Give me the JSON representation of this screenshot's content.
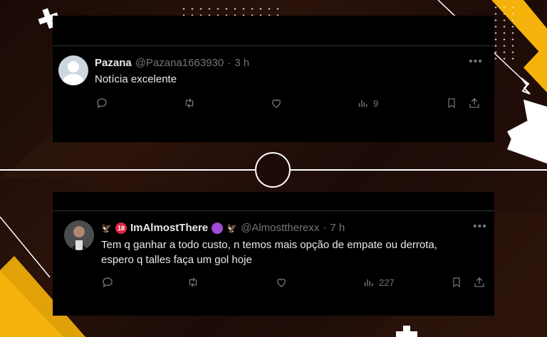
{
  "colors": {
    "accent": "#f5b20a",
    "card_bg": "#000000",
    "text": "#e7e9ea",
    "muted": "#71767b"
  },
  "tweets": [
    {
      "name": "Pazana",
      "handle": "@Pazana1663930",
      "separator": "·",
      "time": "3 h",
      "text": "Notícia excelente",
      "views": "9",
      "icons": [
        "reply-icon",
        "retweet-icon",
        "like-icon",
        "views-icon",
        "bookmark-icon",
        "share-icon"
      ]
    },
    {
      "name_prefix_badge": "18",
      "name": "ImAlmostThere",
      "handle": "@Almosttherexx",
      "separator": "·",
      "time": "7 h",
      "text_line1": "Tem q ganhar a todo custo, n temos mais opção de empate ou derrota,",
      "text_line2": "espero q talles faça um gol hoje",
      "views": "227",
      "icons": [
        "reply-icon",
        "retweet-icon",
        "like-icon",
        "views-icon",
        "bookmark-icon",
        "share-icon"
      ]
    }
  ]
}
